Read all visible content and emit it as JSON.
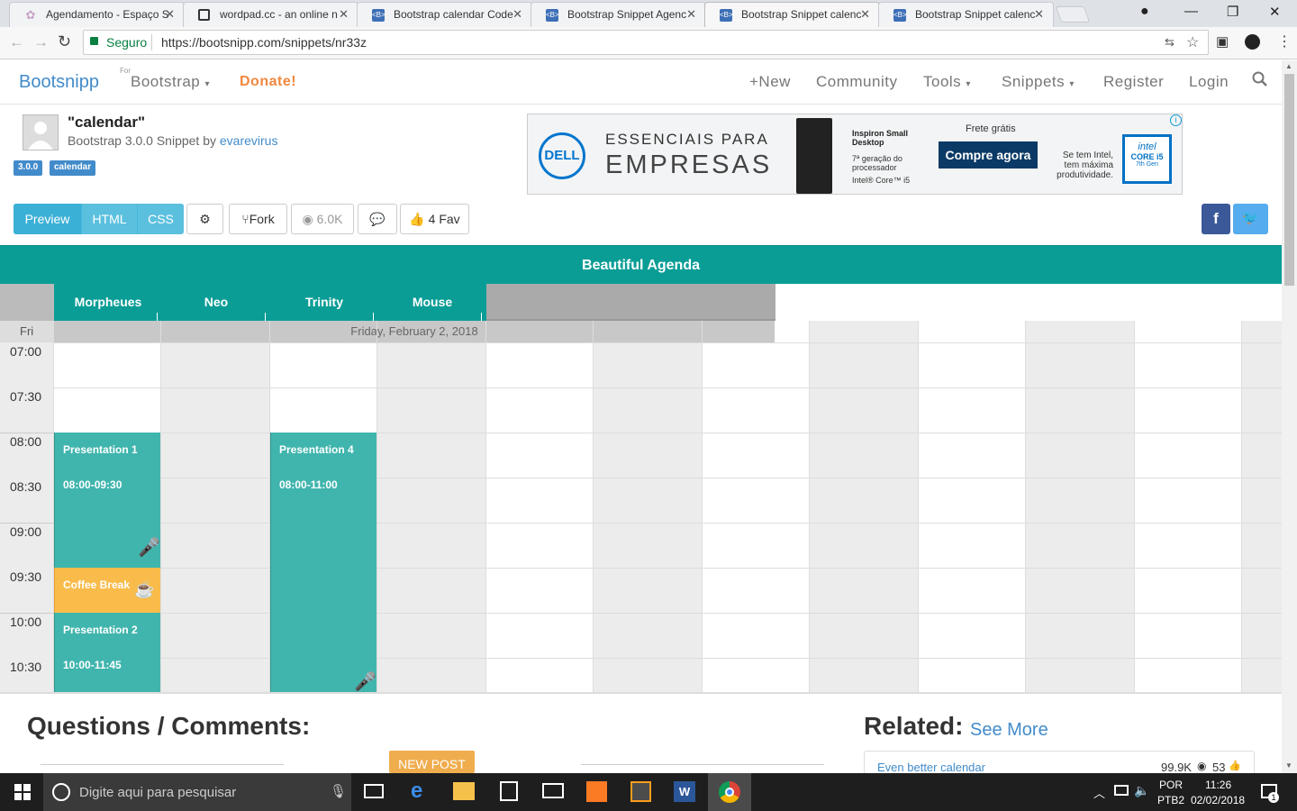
{
  "browser": {
    "tabs": [
      {
        "title": "Agendamento - Espaço S"
      },
      {
        "title": "wordpad.cc - an online n"
      },
      {
        "title": "Bootstrap calendar Code"
      },
      {
        "title": "Bootstrap Snippet Agenc"
      },
      {
        "title": "Bootstrap Snippet calenc"
      },
      {
        "title": "Bootstrap Snippet calenc"
      }
    ],
    "secure_label": "Seguro",
    "url": "https://bootsnipp.com/snippets/nr33z"
  },
  "site_nav": {
    "brand": "Bootsnipp",
    "for_label": "For",
    "bootstrap_menu": "Bootstrap",
    "donate": "Donate!",
    "new": "+New",
    "community": "Community",
    "tools": "Tools",
    "snippets": "Snippets",
    "register": "Register",
    "login": "Login"
  },
  "snippet": {
    "title": "\"calendar\"",
    "subtitle_prefix": "Bootstrap 3.0.0 Snippet by",
    "author": "evarevirus",
    "tags": [
      "3.0.0",
      "calendar"
    ]
  },
  "ad": {
    "brand": "DELL",
    "headline_1": "ESSENCIAIS PARA",
    "headline_2": "EMPRESAS",
    "product": "Inspiron Small Desktop",
    "spec_1": "7ª geração do processador",
    "spec_2": "Intel® Core™ i5",
    "shipping": "Frete grátis",
    "cta": "Compre agora",
    "tagline": "Se tem Intel, tem máxima produtividade.",
    "badge_1": "intel",
    "badge_2": "CORE i5",
    "badge_3": "7th Gen"
  },
  "toolbar": {
    "preview": "Preview",
    "html": "HTML",
    "css": "CSS",
    "fork": "Fork",
    "views": "6.0K",
    "fav": "4 Fav"
  },
  "agenda": {
    "title": "Beautiful Agenda",
    "resources": [
      "Morpheues",
      "Neo",
      "Trinity",
      "Mouse"
    ],
    "day_short": "Fri",
    "date": "Friday, February 2, 2018",
    "times": [
      "07:00",
      "07:30",
      "08:00",
      "08:30",
      "09:00",
      "09:30",
      "10:00",
      "10:30"
    ],
    "events": [
      {
        "title": "Presentation 1",
        "time": "08:00-09:30"
      },
      {
        "title": "Coffee Break",
        "time": ""
      },
      {
        "title": "Presentation 2",
        "time": "10:00-11:45"
      },
      {
        "title": "Presentation 4",
        "time": "08:00-11:00"
      }
    ],
    "colors": {
      "header": "#0a9d96",
      "event": "#40b5ad",
      "coffee": "#f9bc4b"
    }
  },
  "comments": {
    "heading": "Questions / Comments:",
    "new_post": "NEW POST"
  },
  "related": {
    "heading": "Related:",
    "see_more": "See More",
    "items": [
      {
        "title": "Even better calendar",
        "views": "99.9K",
        "likes": "53"
      }
    ]
  },
  "taskbar": {
    "search_placeholder": "Digite aqui para pesquisar",
    "lang_1": "POR",
    "lang_2": "PTB2",
    "time": "11:26",
    "date": "02/02/2018",
    "notif_count": "1"
  }
}
